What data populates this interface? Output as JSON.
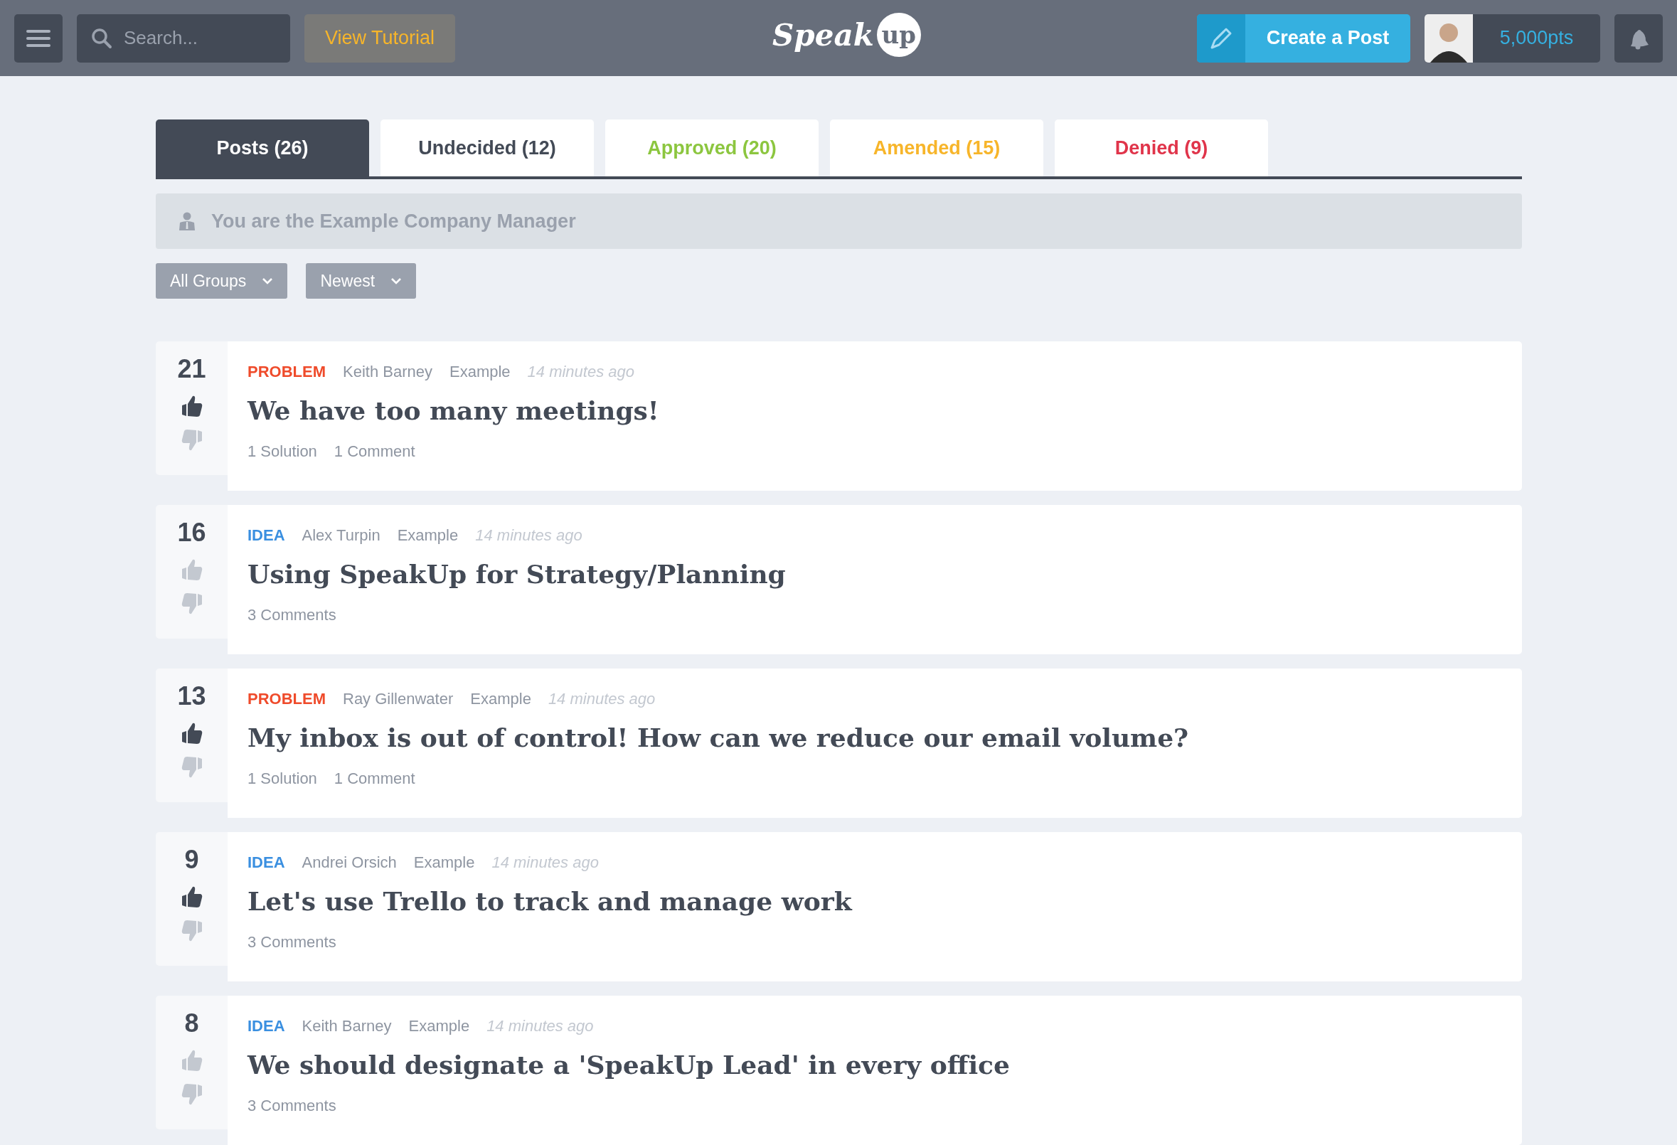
{
  "header": {
    "search": {
      "placeholder": "Search..."
    },
    "tutorial_button": "View Tutorial",
    "logo": {
      "word": "Speak",
      "bubble": "up"
    },
    "create_button": "Create a Post",
    "points": "5,000pts"
  },
  "tabs": [
    {
      "label": "Posts (26)",
      "selected": true,
      "kind": "all"
    },
    {
      "label": "Undecided (12)",
      "selected": false,
      "kind": "undecided"
    },
    {
      "label": "Approved (20)",
      "selected": false,
      "kind": "approved"
    },
    {
      "label": "Amended (15)",
      "selected": false,
      "kind": "amended"
    },
    {
      "label": "Denied (9)",
      "selected": false,
      "kind": "denied"
    }
  ],
  "role_banner": "You are the Example Company Manager",
  "filters": [
    "All Groups",
    "Newest"
  ],
  "posts": [
    {
      "votes": "21",
      "upvoted": true,
      "kind": "problem",
      "type": "PROBLEM",
      "author": "Keith Barney",
      "group": "Example",
      "time": "14 minutes ago",
      "title": "We have too many meetings!",
      "stats": [
        "1 Solution",
        "1 Comment"
      ]
    },
    {
      "votes": "16",
      "upvoted": false,
      "kind": "idea",
      "type": "IDEA",
      "author": "Alex Turpin",
      "group": "Example",
      "time": "14 minutes ago",
      "title": "Using SpeakUp for Strategy/Planning",
      "stats": [
        "3 Comments"
      ]
    },
    {
      "votes": "13",
      "upvoted": true,
      "kind": "problem",
      "type": "PROBLEM",
      "author": "Ray Gillenwater",
      "group": "Example",
      "time": "14 minutes ago",
      "title": "My inbox is out of control! How can we reduce our email volume?",
      "stats": [
        "1 Solution",
        "1 Comment"
      ]
    },
    {
      "votes": "9",
      "upvoted": true,
      "kind": "idea",
      "type": "IDEA",
      "author": "Andrei Orsich",
      "group": "Example",
      "time": "14 minutes ago",
      "title": "Let's use Trello to track and manage work",
      "stats": [
        "3 Comments"
      ]
    },
    {
      "votes": "8",
      "upvoted": false,
      "kind": "idea",
      "type": "IDEA",
      "author": "Keith Barney",
      "group": "Example",
      "time": "14 minutes ago",
      "title": "We should designate a 'SpeakUp Lead' in every office",
      "stats": [
        "3 Comments"
      ]
    }
  ]
}
